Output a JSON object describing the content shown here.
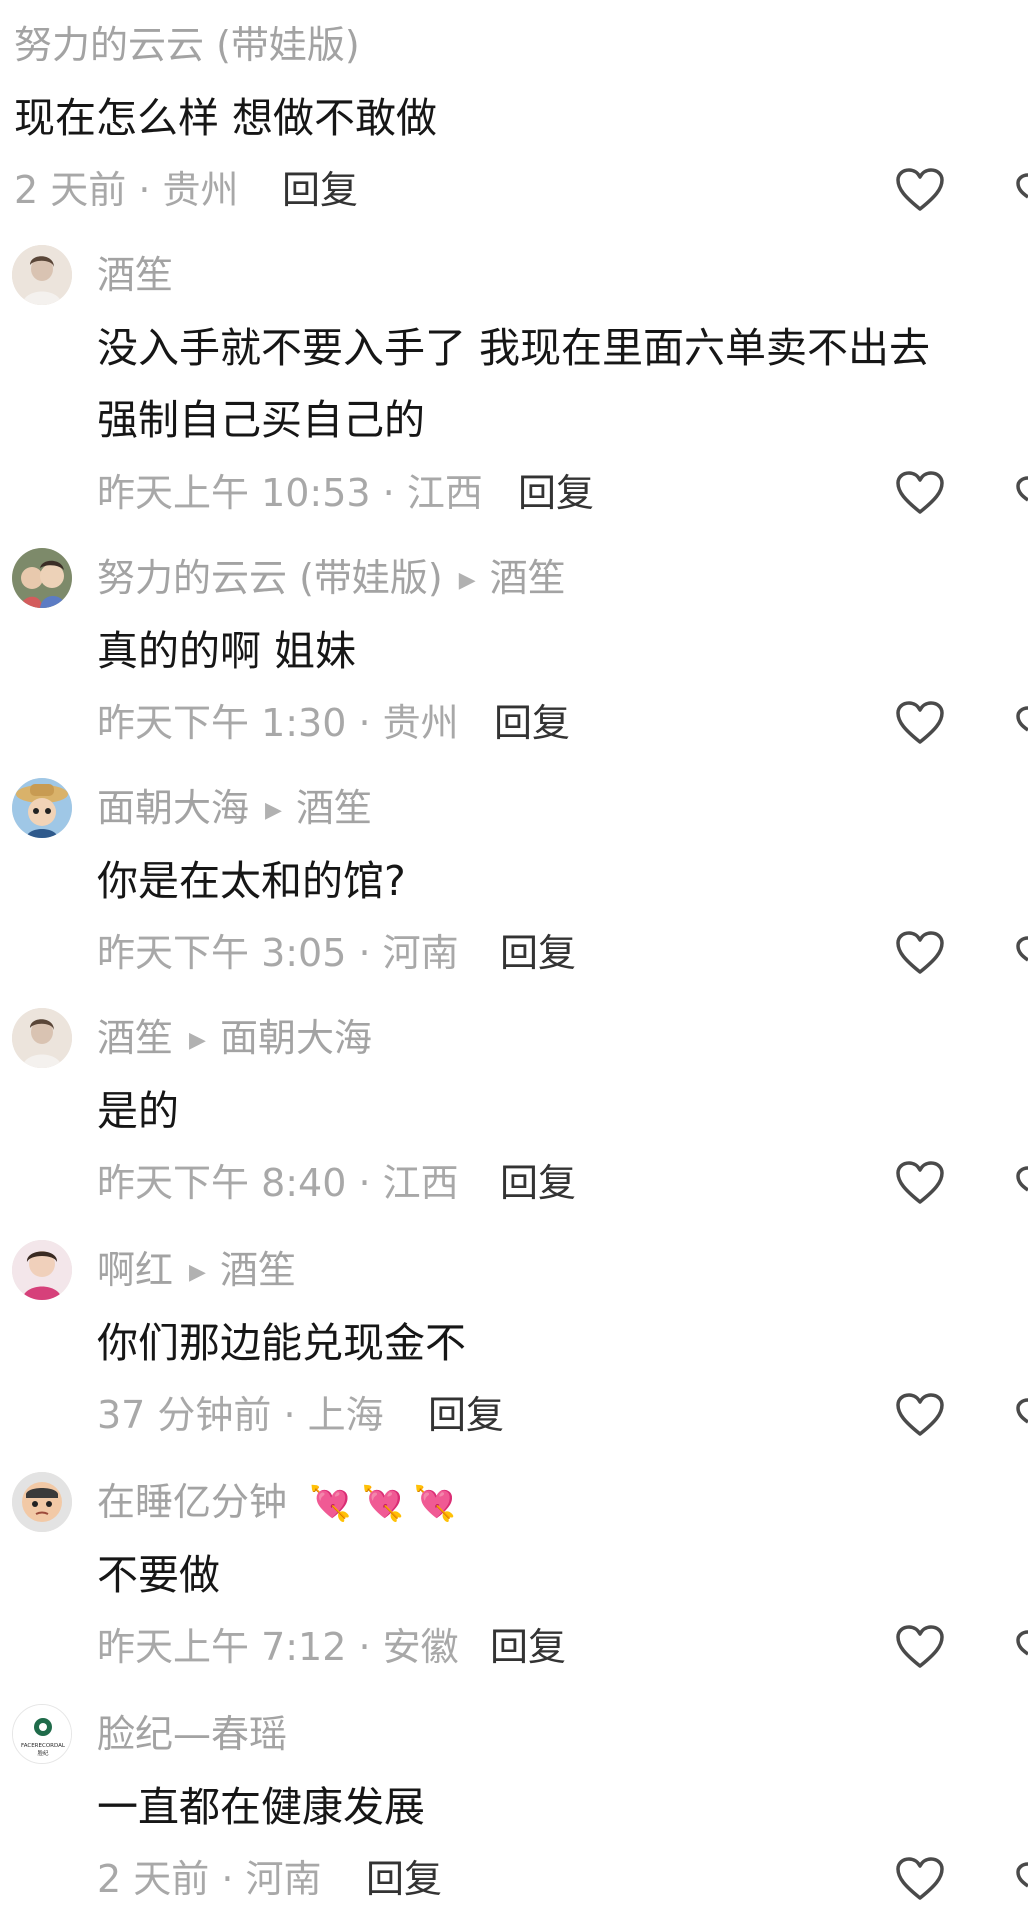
{
  "comments": [
    {
      "author": "努力的云云 (带娃版)",
      "reply_to": "",
      "text": "现在怎么样 想做不敢做",
      "time_location": "2 天前 · 贵州",
      "reply_label": "回复"
    },
    {
      "author": "酒笙",
      "reply_to": "",
      "text": "没入手就不要入手了 我现在里面六单卖不出去\n强制自己买自己的",
      "time_location": "昨天上午 10:53 · 江西",
      "reply_label": "回复"
    },
    {
      "author": "努力的云云 (带娃版)",
      "reply_to": "酒笙",
      "text": "真的的啊 姐妹",
      "time_location": "昨天下午 1:30 · 贵州",
      "reply_label": "回复"
    },
    {
      "author": "面朝大海",
      "reply_to": "酒笙",
      "text": "你是在太和的馆?",
      "time_location": "昨天下午 3:05 · 河南",
      "reply_label": "回复"
    },
    {
      "author": "酒笙",
      "reply_to": "面朝大海",
      "text": "是的",
      "time_location": "昨天下午 8:40 · 江西",
      "reply_label": "回复"
    },
    {
      "author": "啊红",
      "reply_to": "酒笙",
      "text": "你们那边能兑现金不",
      "time_location": "37 分钟前 · 上海",
      "reply_label": "回复"
    },
    {
      "author": "在睡亿分钟",
      "reply_to": "",
      "text": "不要做",
      "time_location": "昨天上午 7:12 · 安徽",
      "reply_label": "回复"
    },
    {
      "author": "脸纪—春瑶",
      "reply_to": "",
      "text": "一直都在健康发展",
      "time_location": "2 天前 · 河南",
      "reply_label": "回复"
    }
  ],
  "emoji_icons": [
    "heart-arrow-icon",
    "heart-arrow-icon",
    "heart-arrow-icon"
  ],
  "avatar_logo_text": "FACERECORDAL 脸纪",
  "icons": {
    "like": "heart-outline-icon",
    "dislike": "broken-heart-icon"
  },
  "colors": {
    "meta_gray": "#a3a3a3",
    "text_dark": "#161616",
    "icon_gray": "#4a4a4a"
  }
}
